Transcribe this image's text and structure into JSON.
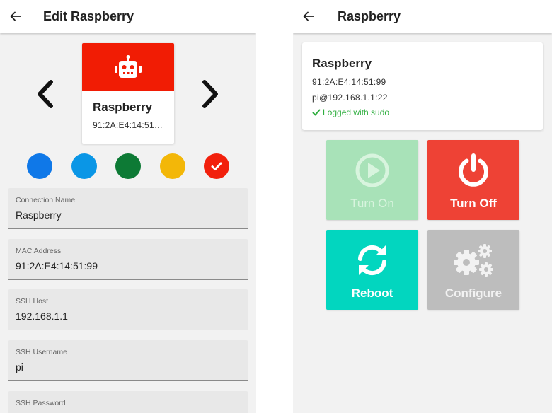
{
  "edit_screen": {
    "title": "Edit Raspberry",
    "device_card": {
      "name": "Raspberry",
      "mac_truncated": "91:2A:E4:14:51…",
      "header_color": "#f11c04",
      "icon": "robot-icon"
    },
    "color_options": [
      {
        "color": "#0f78e8",
        "selected": false
      },
      {
        "color": "#0a96e6",
        "selected": false
      },
      {
        "color": "#0d7a35",
        "selected": false
      },
      {
        "color": "#f3b708",
        "selected": false
      },
      {
        "color": "#f2200c",
        "selected": true
      }
    ],
    "fields": [
      {
        "label": "Connection Name",
        "value": "Raspberry"
      },
      {
        "label": "MAC Address",
        "value": "91:2A:E4:14:51:99"
      },
      {
        "label": "SSH Host",
        "value": "192.168.1.1"
      },
      {
        "label": "SSH Username",
        "value": "pi"
      },
      {
        "label": "SSH Password",
        "value": ""
      }
    ]
  },
  "device_screen": {
    "title": "Raspberry",
    "info": {
      "name": "Raspberry",
      "mac": "91:2A:E4:14:51:99",
      "host": "pi@192.168.1.1:22",
      "status": "Logged with sudo"
    },
    "actions": [
      {
        "label": "Turn On",
        "icon": "play-circle-icon",
        "enabled": false,
        "color": "#a8e2b8"
      },
      {
        "label": "Turn Off",
        "icon": "power-icon",
        "enabled": true,
        "color": "#ee4235"
      },
      {
        "label": "Reboot",
        "icon": "refresh-icon",
        "enabled": true,
        "color": "#02d6bf"
      },
      {
        "label": "Configure",
        "icon": "cogs-icon",
        "enabled": true,
        "color": "#bdbdbd"
      }
    ]
  }
}
